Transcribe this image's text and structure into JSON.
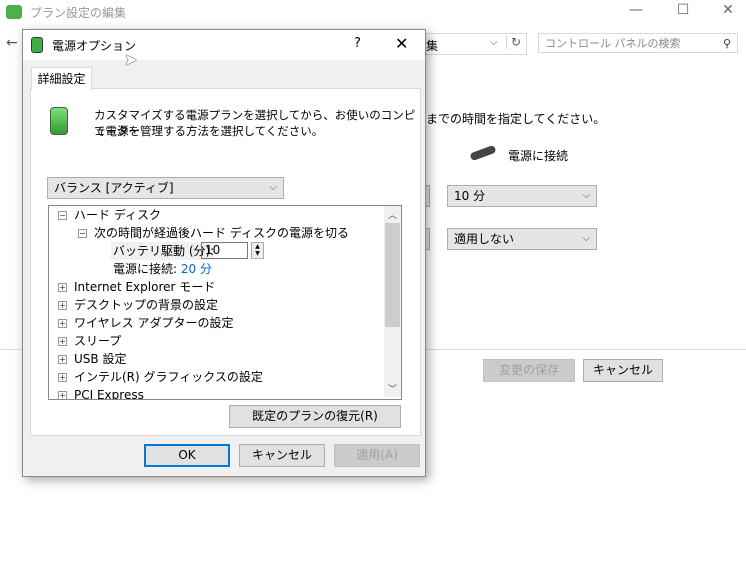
{
  "background": {
    "title": "プラン設定の編集",
    "address_tail": "集",
    "search_placeholder": "コントロール パネルの検索",
    "description_tail": "までの時間を指定してください。",
    "plugged_in_label": "電源に接続",
    "display_off_value": "10 分",
    "sleep_value": "適用しない",
    "save_label": "変更の保存",
    "cancel_label": "キャンセル"
  },
  "dialog": {
    "title": "電源オプション",
    "help": "?",
    "tab": "詳細設定",
    "description_line1": "カスタマイズする電源プランを選択してから、お使いのコンピューター",
    "description_line2": "で電源を管理する方法を選択してください。",
    "plan": "バランス [アクティブ]",
    "tree": {
      "hard_disk": "ハード ディスク",
      "turn_off_after": "次の時間が経過後ハード ディスクの電源を切る",
      "battery_label": "バッテリ駆動 (分):",
      "battery_value": "10",
      "plugged_label": "電源に接続:",
      "plugged_value": "20 分",
      "items": [
        "Internet Explorer モード",
        "デスクトップの背景の設定",
        "ワイヤレス アダプターの設定",
        "スリープ",
        "USB 設定",
        "インテル(R) グラフィックスの設定",
        "PCI Express"
      ]
    },
    "restore_label": "既定のプランの復元(R)",
    "ok_label": "OK",
    "cancel_label": "キャンセル",
    "apply_label": "適用(A)"
  }
}
